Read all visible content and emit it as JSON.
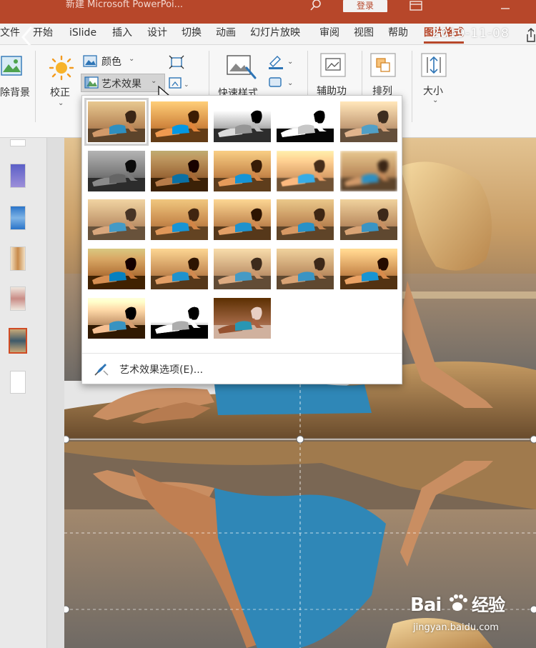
{
  "window": {
    "title": "新建 Microsoft PowerPoi...",
    "login_label": "登录"
  },
  "tabs": [
    {
      "label": "文件"
    },
    {
      "label": "开始"
    },
    {
      "label": "iSlide"
    },
    {
      "label": "插入"
    },
    {
      "label": "设计"
    },
    {
      "label": "切换"
    },
    {
      "label": "动画"
    },
    {
      "label": "幻灯片放映"
    },
    {
      "label": "审阅"
    },
    {
      "label": "视图"
    },
    {
      "label": "帮助"
    },
    {
      "label": "图片格式",
      "active": true
    }
  ],
  "overlay_date": "2019-11-08",
  "ribbon": {
    "remove_bg_label": "除背景",
    "corrections_label": "校正",
    "color_label": "颜色",
    "artistic_effects_label": "艺术效果",
    "quick_styles_label": "快速样式",
    "assist_label": "辅助功",
    "arrange_label": "排列",
    "size_label": "大小"
  },
  "gallery": {
    "options_label": "艺术效果选项(E)...",
    "effects": [
      "none",
      "marker",
      "pencil-grayscale",
      "pencil-sketch",
      "line-drawing",
      "chalk-sketch",
      "paint-strokes",
      "paint-brush",
      "glow-diffused",
      "blur",
      "light-screen",
      "watercolor-sponge",
      "film-grain",
      "mosaic-bubbles",
      "glass",
      "cement",
      "texturizer",
      "crisscross-etching",
      "pastels-smooth",
      "plastic-wrap",
      "cutout",
      "photocopy",
      "glow-edges"
    ]
  },
  "watermark": {
    "logo": "Bai  经验",
    "url": "jingyan.baidu.com"
  },
  "colors": {
    "accent": "#b7472a",
    "ribbon_bg": "#f7f7f7"
  }
}
